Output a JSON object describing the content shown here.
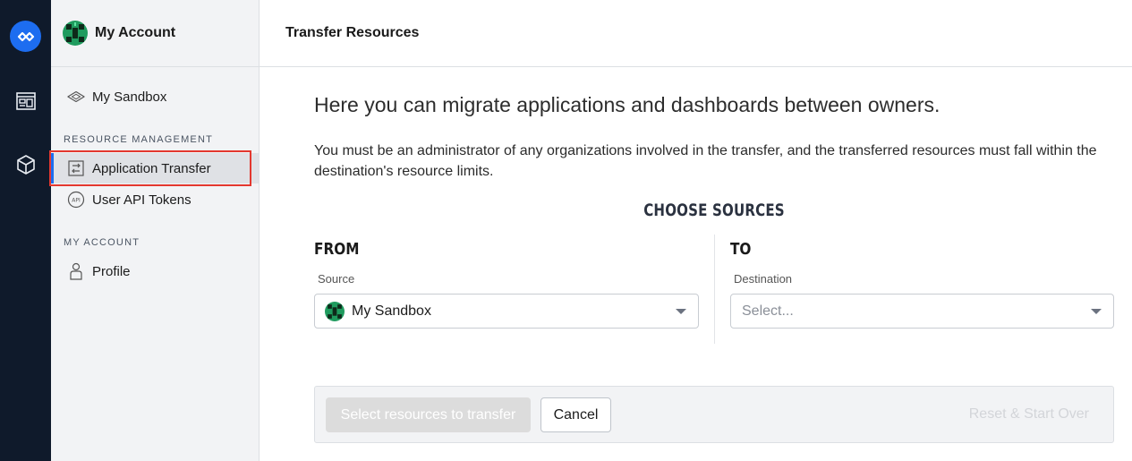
{
  "account": {
    "title": "My Account"
  },
  "sidebar": {
    "sandbox_label": "My Sandbox",
    "resource_section": "RESOURCE MANAGEMENT",
    "items": [
      {
        "label": "Application Transfer",
        "icon": "transfer-icon",
        "active": true
      },
      {
        "label": "User API Tokens",
        "icon": "api-token-icon",
        "active": false
      }
    ],
    "account_section": "MY ACCOUNT",
    "profile_label": "Profile"
  },
  "header": {
    "title": "Transfer Resources"
  },
  "main": {
    "intro": "Here you can migrate applications and dashboards between owners.",
    "description": "You must be an administrator of any organizations involved in the transfer, and the transferred resources must fall within the destination's resource limits.",
    "choose_title": "CHOOSE SOURCES",
    "from": {
      "title": "FROM",
      "field_label": "Source",
      "value": "My Sandbox"
    },
    "to": {
      "title": "TO",
      "field_label": "Destination",
      "placeholder": "Select..."
    }
  },
  "actions": {
    "select_resources": "Select resources to transfer",
    "cancel": "Cancel",
    "reset": "Reset & Start Over"
  },
  "colors": {
    "rail_bg": "#0f1a2b",
    "accent": "#1d6df0",
    "highlight": "#e3382f",
    "sidebar_bg": "#f2f3f5"
  }
}
